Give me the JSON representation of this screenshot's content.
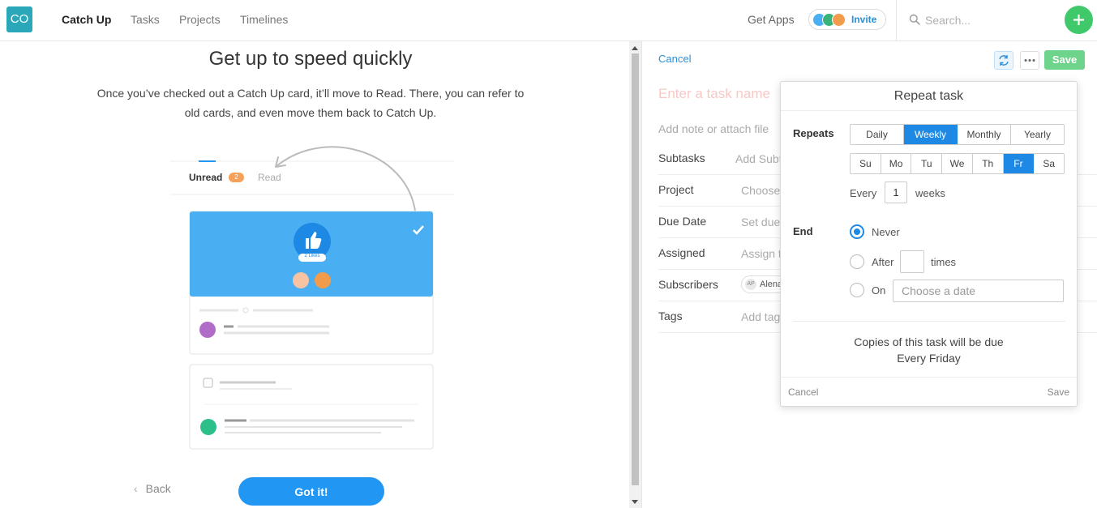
{
  "app": {
    "logo_text": "CO"
  },
  "nav": {
    "items": [
      {
        "label": "Catch Up",
        "active": true
      },
      {
        "label": "Tasks",
        "active": false
      },
      {
        "label": "Projects",
        "active": false
      },
      {
        "label": "Timelines",
        "active": false
      }
    ]
  },
  "header": {
    "get_apps": "Get Apps",
    "invite": "Invite",
    "search_placeholder": "Search...",
    "add_icon": "plus-icon"
  },
  "onboarding": {
    "title": "Get up to speed quickly",
    "description": "Once you’ve checked out a Catch Up card, it’ll move to Read. There, you can refer to old cards, and even move them back to Catch Up.",
    "tab_unread": "Unread",
    "tab_unread_count": "2",
    "tab_read": "Read",
    "likes_label": "2 Likes",
    "back": "Back",
    "got_it": "Got it!"
  },
  "task": {
    "cancel": "Cancel",
    "save": "Save",
    "name_placeholder": "Enter a task name",
    "note_placeholder": "Add note or attach file",
    "fields": [
      {
        "label": "Subtasks",
        "value": "Add Subtask"
      },
      {
        "label": "Project",
        "value": "Choose a project"
      },
      {
        "label": "Due Date",
        "value": "Set due date"
      },
      {
        "label": "Assigned",
        "value": "Assign to"
      },
      {
        "label": "Subscribers",
        "value": "Alena"
      },
      {
        "label": "Tags",
        "value": "Add tags"
      }
    ],
    "subscriber_initials": "AP"
  },
  "repeat": {
    "title": "Repeat task",
    "repeats_label": "Repeats",
    "frequency": [
      "Daily",
      "Weekly",
      "Monthly",
      "Yearly"
    ],
    "frequency_selected": "Weekly",
    "days": [
      "Su",
      "Mo",
      "Tu",
      "We",
      "Th",
      "Fr",
      "Sa"
    ],
    "days_selected": [
      "Fr"
    ],
    "every_label": "Every",
    "every_value": "1",
    "weeks_label": "weeks",
    "end_label": "End",
    "end_never": "Never",
    "end_after": "After",
    "end_after_unit": "times",
    "end_on": "On",
    "date_placeholder": "Choose a date",
    "end_selected": "Never",
    "summary_line1": "Copies of this task will be due",
    "summary_line2": "Every Friday",
    "cancel": "Cancel",
    "save": "Save"
  },
  "colors": {
    "accent": "#1e88e5",
    "logo": "#2aa7b8",
    "add": "#3fc96b",
    "save": "#6fd48b",
    "badge": "#f5a15a",
    "card_header": "#4aaef2"
  }
}
